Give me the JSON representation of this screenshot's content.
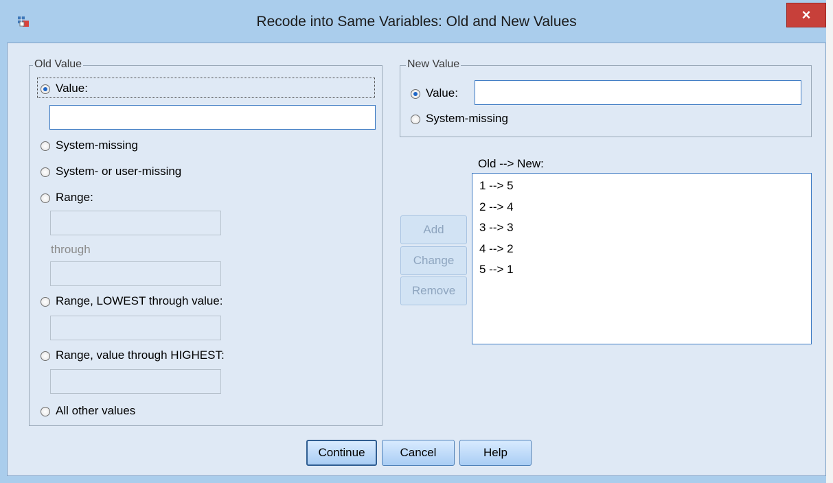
{
  "window": {
    "title": "Recode into Same Variables: Old and New Values",
    "close_glyph": "×"
  },
  "old_value": {
    "legend": "Old Value",
    "options": [
      {
        "label": "Value:",
        "checked": true
      },
      {
        "label": "System-missing",
        "checked": false
      },
      {
        "label": "System- or user-missing",
        "checked": false
      },
      {
        "label": "Range:",
        "checked": false
      },
      {
        "label": "Range, LOWEST through value:",
        "checked": false
      },
      {
        "label": "Range, value through HIGHEST:",
        "checked": false
      },
      {
        "label": "All other values",
        "checked": false
      }
    ],
    "value_input": "",
    "range_from": "",
    "through_label": "through",
    "range_to": "",
    "lowest_through_value": "",
    "value_through_highest": ""
  },
  "new_value": {
    "legend": "New Value",
    "options": [
      {
        "label": "Value:",
        "checked": true
      },
      {
        "label": "System-missing",
        "checked": false
      }
    ],
    "value_input": ""
  },
  "mapping": {
    "header": "Old --> New:",
    "items": [
      "1 --> 5",
      "2 --> 4",
      "3 --> 3",
      "4 --> 2",
      "5 --> 1"
    ]
  },
  "list_buttons": {
    "add": "Add",
    "change": "Change",
    "remove": "Remove"
  },
  "footer": {
    "continue": "Continue",
    "cancel": "Cancel",
    "help": "Help"
  },
  "icons": {
    "app": "spss-recode-icon",
    "close": "close-icon",
    "radio": "radio-icon"
  },
  "colors": {
    "title_bar": "#aacdec",
    "close_button": "#c7403a",
    "client_bg": "#dfe9f5",
    "selected_radio": "#1e66c7",
    "focus_border": "#3a78c2"
  }
}
